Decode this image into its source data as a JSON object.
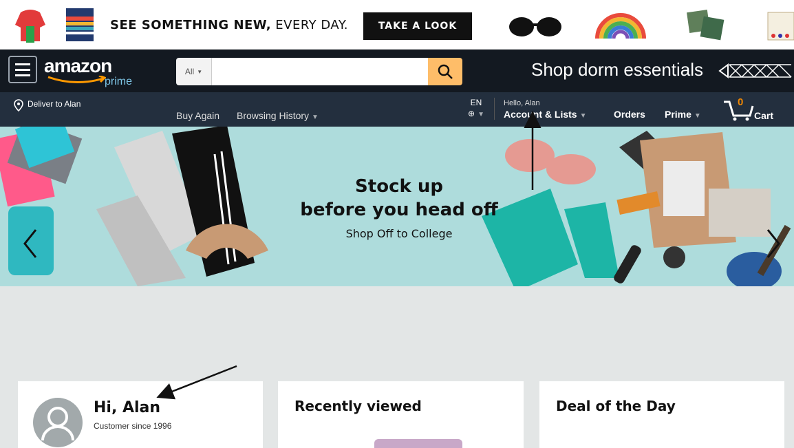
{
  "promo": {
    "text_bold": "SEE SOMETHING NEW,",
    "text_rest": " EVERY DAY.",
    "button": "TAKE A LOOK"
  },
  "header": {
    "logo_text": "amazon",
    "logo_sub": "prime",
    "search_category": "All",
    "search_value": "",
    "promo_link": "Shop dorm essentials"
  },
  "nav": {
    "deliver": "Deliver to Alan",
    "links": [
      "Buy Again",
      "Browsing History"
    ],
    "language": "EN",
    "hello": "Hello, Alan",
    "account": "Account & Lists",
    "orders": "Orders",
    "prime": "Prime",
    "cart_count": "0",
    "cart": "Cart"
  },
  "hero": {
    "title_line1": "Stock up",
    "title_line2": "before you head off",
    "subtitle": "Shop Off to College"
  },
  "cards": {
    "greeting": "Hi, Alan",
    "customer_since": "Customer since 1996",
    "recently_viewed": "Recently viewed",
    "deal_of_day": "Deal of the Day"
  },
  "colors": {
    "nav_top": "#131921",
    "nav_bottom": "#232f3e",
    "search_button": "#febd69",
    "hero_bg": "#aedcdc",
    "cart_count": "#f08804"
  }
}
